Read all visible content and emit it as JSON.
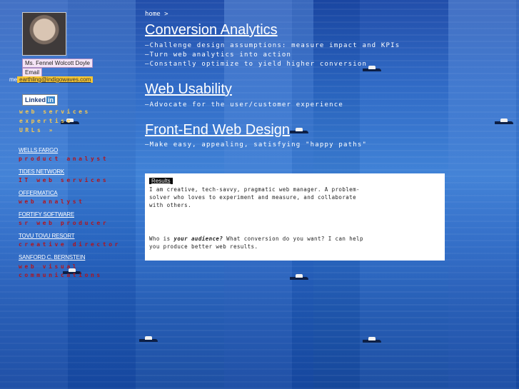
{
  "profile": {
    "name": "Ms. Fennel Wolcott Doyle",
    "email_label": "Email",
    "email_prefix": "me",
    "email_address": "earthling@indigowaves.com"
  },
  "linkedin": {
    "text": "Linked",
    "in": "in"
  },
  "side_nav": [
    {
      "label": "web services"
    },
    {
      "label": "expertise"
    },
    {
      "label": "URLs »"
    }
  ],
  "jobs": [
    {
      "company": "WELLS FARGO",
      "role": "product analyst"
    },
    {
      "company": "TIDES NETWORK",
      "role": "IT web services"
    },
    {
      "company": "OFFERMATICA",
      "role": "web analyst"
    },
    {
      "company": "FORTIFY SOFTWARE",
      "role": "sr web producer"
    },
    {
      "company": "TOVU TOVU RESORT",
      "role": "creative director"
    },
    {
      "company": "SANFORD C. BERNSTEIN",
      "role": "web visual communications"
    }
  ],
  "breadcrumb": "home >",
  "sections": [
    {
      "title": "Conversion Analytics",
      "lines": [
        "—Challenge design assumptions: measure impact and KPIs",
        "—Turn web analytics into action",
        "—Constantly optimize to yield higher conversion"
      ]
    },
    {
      "title": "Web Usability",
      "lines": [
        "—Advocate for the user/customer experience"
      ]
    },
    {
      "title": "Front-End Web Design",
      "lines": [
        "—Make easy, appealing, satisfying \"happy paths\""
      ]
    }
  ],
  "results": {
    "badge": "Results",
    "intro": "I am creative, tech-savvy, pragmatic web manager. A problem-solver who loves to experiment and measure, and collaborate with others.",
    "q_pre": "Who is ",
    "q_em": "your audience?",
    "q_post": " What conversion do you want? I can help you produce better web results."
  }
}
